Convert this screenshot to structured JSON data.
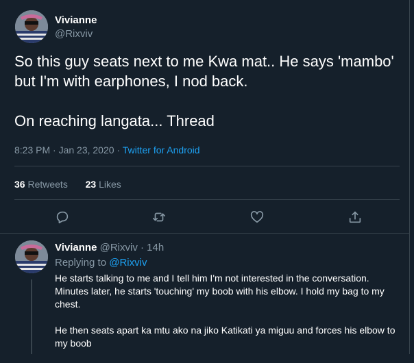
{
  "tweet": {
    "author_name": "Vivianne",
    "author_handle": "@Rixviv",
    "paragraphs": [
      "So this guy seats next to me Kwa mat.. He says 'mambo' but I'm with earphones, I nod back.",
      "On reaching langata... Thread"
    ],
    "time": "8:23 PM · Jan 23, 2020 · ",
    "source": "Twitter for Android",
    "retweets_count": "36",
    "retweets_label": " Retweets",
    "likes_count": "23",
    "likes_label": " Likes"
  },
  "icons": {
    "reply": "reply-icon",
    "retweet": "retweet-icon",
    "like": "heart-icon",
    "share": "share-icon"
  },
  "reply": {
    "author_name": "Vivianne",
    "author_handle_time": "@Rixviv · 14h",
    "replying_prefix": "Replying to ",
    "replying_to": "@Rixviv",
    "paragraphs": [
      "He starts talking to me and I tell him I'm not interested in the conversation. Minutes later, he starts 'touching' my boob with his elbow. I hold my bag to my chest.",
      "He then seats apart ka mtu ako na jiko Katikati ya miguu and forces his elbow to my boob"
    ]
  },
  "colors": {
    "background": "#15202b",
    "muted": "#8899a6",
    "accent": "#1da1f2",
    "divider": "#38444d"
  }
}
